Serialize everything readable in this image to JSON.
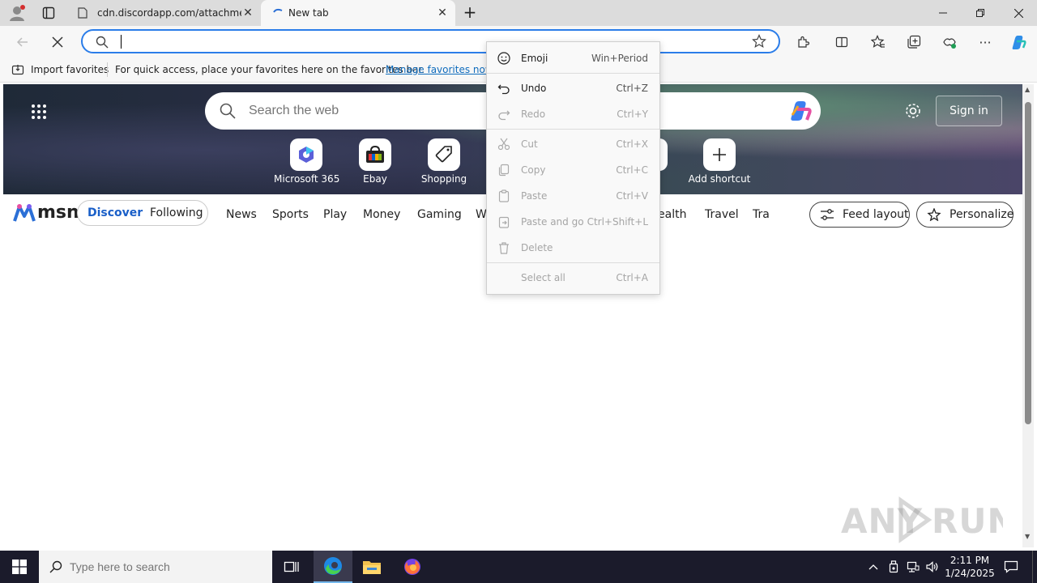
{
  "tabs": [
    {
      "title": "cdn.discordapp.com/attachments",
      "active": false
    },
    {
      "title": "New tab",
      "active": true
    }
  ],
  "address": {
    "value": "",
    "placeholder": ""
  },
  "favorites_bar": {
    "import_label": "Import favorites",
    "message": "For quick access, place your favorites here on the favorites bar.",
    "manage_link": "Manage favorites now"
  },
  "newtab": {
    "search_placeholder": "Search the web",
    "signin_label": "Sign in",
    "shortcuts": [
      {
        "label": "Microsoft 365",
        "icon": "microsoft365-icon"
      },
      {
        "label": "Ebay",
        "icon": "ebay-icon"
      },
      {
        "label": "Shopping",
        "icon": "tag-icon"
      },
      {
        "label": "Add shortcut",
        "icon": "plus-icon"
      }
    ]
  },
  "msn": {
    "logo_text": "msn",
    "toggle": {
      "discover": "Discover",
      "following": "Following"
    },
    "nav": [
      "News",
      "Sports",
      "Play",
      "Money",
      "Gaming",
      "W",
      "ealth",
      "Travel",
      "Tra"
    ],
    "feed_layout": "Feed layout",
    "personalize": "Personalize"
  },
  "context_menu": {
    "items": [
      {
        "label": "Emoji",
        "shortcut": "Win+Period",
        "enabled": true,
        "icon": "emoji-icon"
      },
      {
        "label": "Undo",
        "shortcut": "Ctrl+Z",
        "enabled": true,
        "icon": "undo-icon"
      },
      {
        "label": "Redo",
        "shortcut": "Ctrl+Y",
        "enabled": false,
        "icon": "redo-icon"
      },
      {
        "label": "Cut",
        "shortcut": "Ctrl+X",
        "enabled": false,
        "icon": "cut-icon"
      },
      {
        "label": "Copy",
        "shortcut": "Ctrl+C",
        "enabled": false,
        "icon": "copy-icon"
      },
      {
        "label": "Paste",
        "shortcut": "Ctrl+V",
        "enabled": false,
        "icon": "paste-icon"
      },
      {
        "label": "Paste and go",
        "shortcut": "Ctrl+Shift+L",
        "enabled": false,
        "icon": "paste-go-icon"
      },
      {
        "label": "Delete",
        "shortcut": "",
        "enabled": false,
        "icon": "delete-icon"
      },
      {
        "label": "Select all",
        "shortcut": "Ctrl+A",
        "enabled": false,
        "icon": ""
      }
    ]
  },
  "taskbar": {
    "search_placeholder": "Type here to search",
    "time": "2:11 PM",
    "date": "1/24/2025"
  },
  "watermark": "ANY RUN",
  "colors": {
    "accent": "#2b7de9",
    "link": "#0f6cbd",
    "taskbar": "#1b1b2b"
  }
}
